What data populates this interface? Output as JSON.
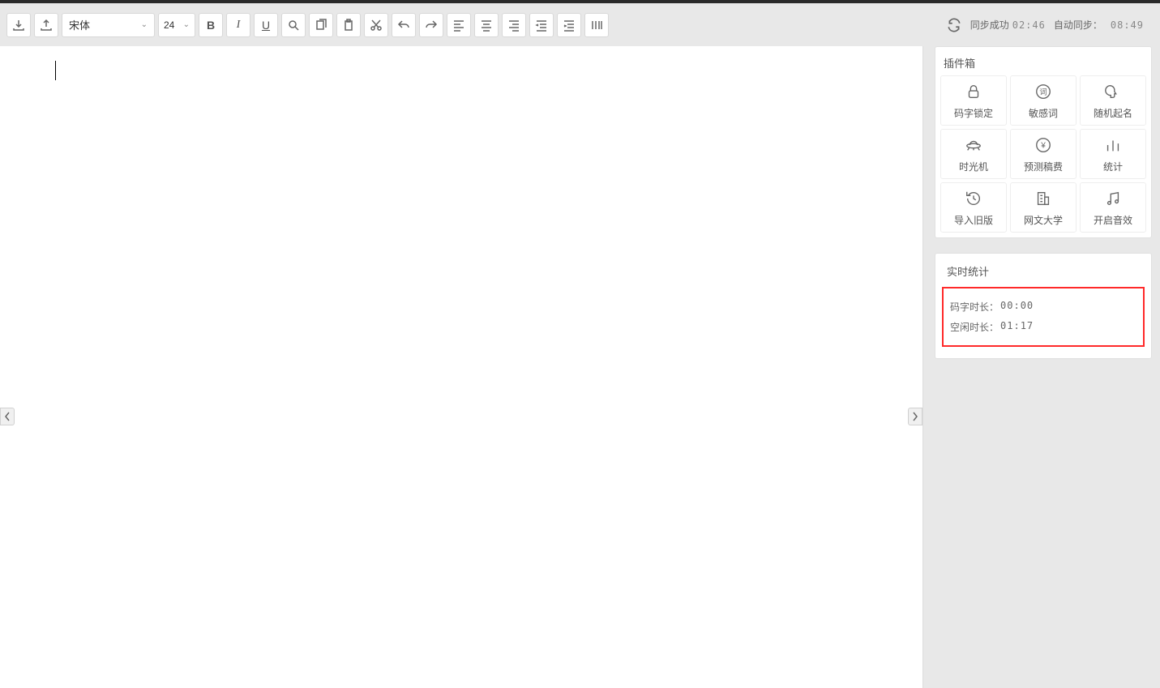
{
  "toolbar": {
    "font_name": "宋体",
    "font_size": "24"
  },
  "sync": {
    "status_label": "同步成功",
    "status_time": "02:46",
    "auto_label": "自动同步：",
    "auto_time": "08:49"
  },
  "plugins": {
    "title": "插件箱",
    "items": [
      {
        "label": "码字锁定",
        "icon": "lock-icon"
      },
      {
        "label": "敏感词",
        "icon": "word-icon"
      },
      {
        "label": "随机起名",
        "icon": "head-icon"
      },
      {
        "label": "时光机",
        "icon": "ufo-icon"
      },
      {
        "label": "预测稿费",
        "icon": "yen-icon"
      },
      {
        "label": "统计",
        "icon": "bars-icon"
      },
      {
        "label": "导入旧版",
        "icon": "history-icon"
      },
      {
        "label": "网文大学",
        "icon": "building-icon"
      },
      {
        "label": "开启音效",
        "icon": "music-icon"
      }
    ]
  },
  "stats": {
    "title": "实时统计",
    "rows": [
      {
        "label": "码字时长：",
        "value": "00:00"
      },
      {
        "label": "空闲时长：",
        "value": "01:17"
      }
    ]
  }
}
